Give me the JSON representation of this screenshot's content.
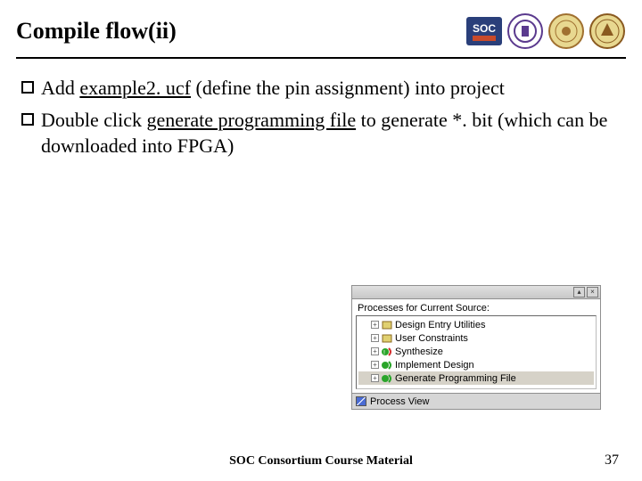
{
  "title": "Compile flow(ii)",
  "bullets": [
    {
      "pre": "Add ",
      "underlined": "example2. ucf",
      "post": " (define the pin assignment) into project"
    },
    {
      "pre": "Double click ",
      "underlined": "generate programming file",
      "post": " to generate *. bit (which can be downloaded into FPGA)"
    }
  ],
  "panel": {
    "heading": "Processes for Current Source:",
    "items": [
      {
        "label": "Design Entry Utilities",
        "status": "none"
      },
      {
        "label": "User Constraints",
        "status": "none"
      },
      {
        "label": "Synthesize",
        "status": "warn"
      },
      {
        "label": "Implement Design",
        "status": "ok"
      },
      {
        "label": "Generate Programming File",
        "status": "ok",
        "selected": true
      }
    ],
    "tab": "Process View"
  },
  "footer": "SOC Consortium Course Material",
  "pagenum": "37"
}
